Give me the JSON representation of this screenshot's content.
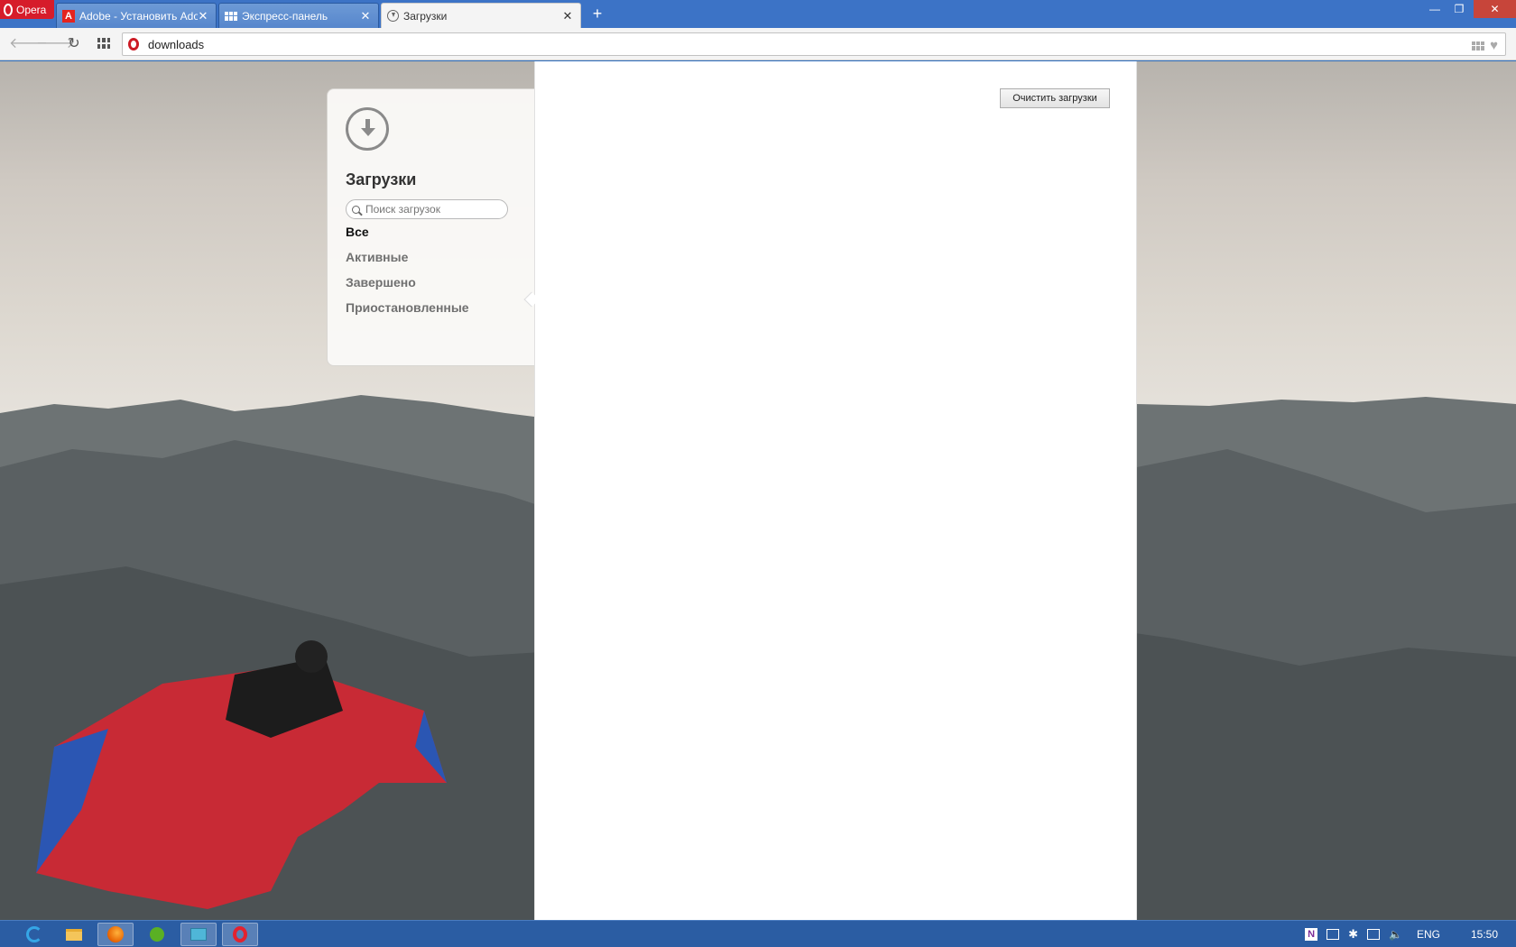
{
  "window": {
    "app_menu_label": "Opera",
    "minimize_glyph": "—",
    "restore_glyph": "❐",
    "close_glyph": "✕"
  },
  "tabs": [
    {
      "title": "Adobe - Установить Adobe",
      "icon": "adobe-icon",
      "active": false
    },
    {
      "title": "Экспресс-панель",
      "icon": "speed-dial-icon",
      "active": false
    },
    {
      "title": "Загрузки",
      "icon": "download-icon",
      "active": true
    }
  ],
  "tab_close_glyph": "✕",
  "new_tab_glyph": "+",
  "toolbar": {
    "back_glyph": "🡐",
    "forward_glyph": "🡒",
    "reload_glyph": "↻",
    "url": "downloads",
    "heart_glyph": "♥"
  },
  "downloads_page": {
    "title": "Загрузки",
    "search_placeholder": "Поиск загрузок",
    "filters": [
      "Все",
      "Активные",
      "Завершено",
      "Приостановленные"
    ],
    "selected_filter": "Все",
    "clear_button": "Очистить загрузки"
  },
  "taskbar": {
    "apps": [
      "internet-explorer-icon",
      "file-explorer-icon",
      "firefox-icon",
      "green-app-icon",
      "app-icon",
      "opera-icon"
    ],
    "tray": {
      "onenote_glyph": "N",
      "bluetooth_glyph": "✱",
      "volume_glyph": "🔈",
      "language": "ENG",
      "time": "15:50"
    }
  },
  "colors": {
    "tabbar": "#3c73c6",
    "opera_red": "#d61c2a",
    "taskbar": "#2b5da3"
  }
}
